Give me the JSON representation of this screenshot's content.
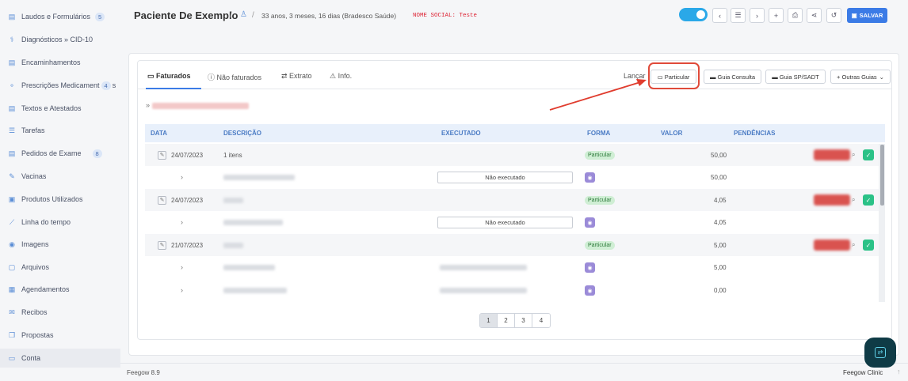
{
  "sidebar": {
    "items": [
      {
        "label": "Laudos e Formulários",
        "icon": "document-icon",
        "badge": "5"
      },
      {
        "label": "Diagnósticos » CID-10",
        "icon": "stethoscope-icon"
      },
      {
        "label": "Encaminhamentos",
        "icon": "document-icon"
      },
      {
        "label": "Prescrições Medicament",
        "icon": "pills-icon",
        "badge": "4",
        "suffix": "s"
      },
      {
        "label": "Textos e Atestados",
        "icon": "document-icon"
      },
      {
        "label": "Tarefas",
        "icon": "list-icon"
      },
      {
        "label": "Pedidos de Exame",
        "icon": "document-icon",
        "badge": "8"
      },
      {
        "label": "Vacinas",
        "icon": "syringe-icon"
      },
      {
        "label": "Produtos Utilizados",
        "icon": "box-icon"
      },
      {
        "label": "Linha do tempo",
        "icon": "chart-icon"
      },
      {
        "label": "Imagens",
        "icon": "camera-icon"
      },
      {
        "label": "Arquivos",
        "icon": "file-icon"
      },
      {
        "label": "Agendamentos",
        "icon": "calendar-icon"
      },
      {
        "label": "Recibos",
        "icon": "receipt-icon"
      },
      {
        "label": "Propostas",
        "icon": "copy-icon"
      },
      {
        "label": "Conta",
        "icon": "money-icon"
      }
    ]
  },
  "header": {
    "patient_name": "Paciente De Exemplo",
    "patient_info": "33 anos, 3 meses, 16 dias (Bradesco Saúde)",
    "social_name": "NOME SOCIAL: Teste",
    "save_label": "SALVAR"
  },
  "tabs": {
    "faturados": "Faturados",
    "nao_faturados": "Não faturados",
    "extrato": "Extrato",
    "info": "Info.",
    "lancar": "Lançar",
    "particular": "Particular",
    "guia_consulta": "Guia Consulta",
    "guia_sadt": "Guia SP/SADT",
    "outras_guias": "+ Outras Guias"
  },
  "table": {
    "headers": {
      "data": "DATA",
      "descricao": "DESCRIÇÃO",
      "executado": "EXECUTADO",
      "forma": "FORMA",
      "valor": "VALOR",
      "pendencias": "PENDÊNCIAS"
    },
    "rows": [
      {
        "date": "24/07/2023",
        "description": "1 itens",
        "forma": "Particular",
        "valor": "50,00",
        "sub_valor": "50,00",
        "sub_executed": "Não executado"
      },
      {
        "date": "24/07/2023",
        "description": "",
        "forma": "Particular",
        "valor": "4,05",
        "sub_valor": "4,05",
        "sub_executed": "Não executado"
      },
      {
        "date": "21/07/2023",
        "description": "",
        "forma": "Particular",
        "valor": "5,00",
        "sub_valor": "5,00",
        "sub_valor2": "0,00"
      }
    ]
  },
  "pager": [
    "1",
    "2",
    "3",
    "4"
  ],
  "footer": {
    "version": "Feegow 8.9",
    "brand": "Feegow Clinic"
  },
  "colors": {
    "accent": "#3b7be6",
    "highlight": "#e04a3a",
    "success": "#2bc287"
  }
}
